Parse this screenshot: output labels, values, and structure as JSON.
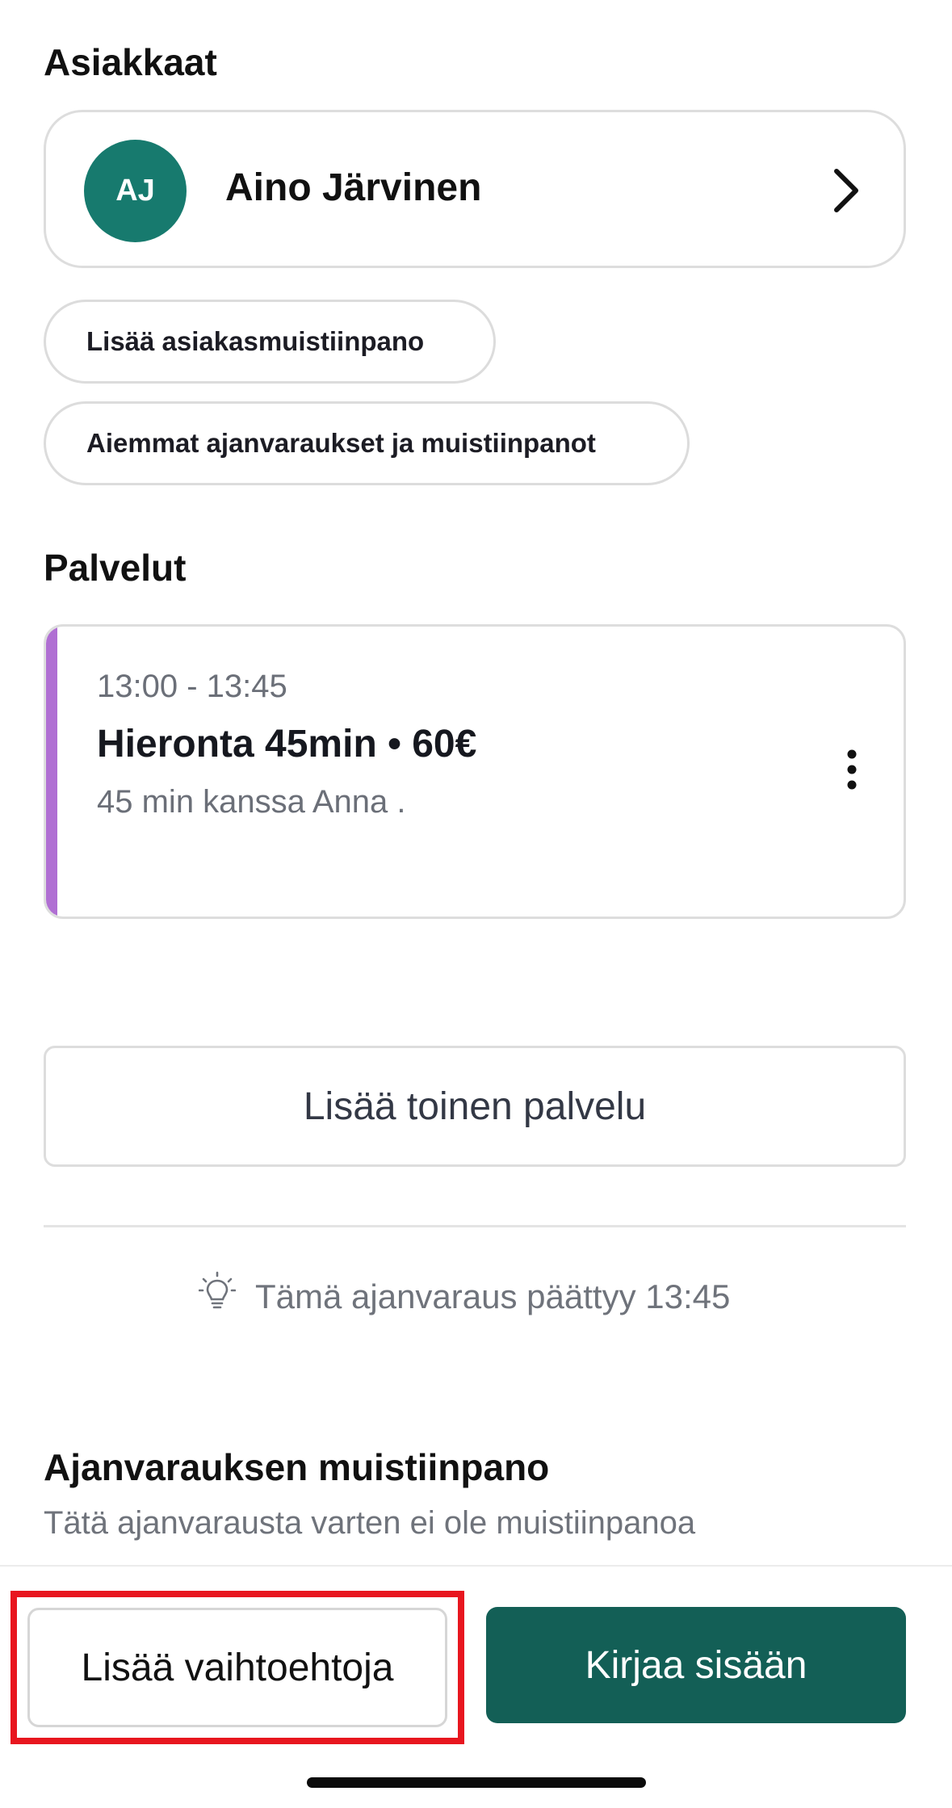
{
  "clients": {
    "section_title": "Asiakkaat",
    "client": {
      "initials": "AJ",
      "name": "Aino Järvinen",
      "avatar_color": "#177a6e"
    },
    "add_note_label": "Lisää asiakasmuistiinpano",
    "history_label": "Aiemmat ajanvaraukset ja muistiinpanot"
  },
  "services": {
    "section_title": "Palvelut",
    "items": [
      {
        "time": "13:00 - 13:45",
        "title": "Hieronta 45min • 60€",
        "meta": "45 min kanssa Anna .",
        "accent_color": "#b06fd3"
      }
    ],
    "add_service_label": "Lisää toinen palvelu"
  },
  "hint": {
    "text": "Tämä ajanvaraus päättyy 13:45",
    "icon": "lightbulb-icon"
  },
  "booking_note": {
    "title": "Ajanvarauksen muistiinpano",
    "empty_text": "Tätä ajanvarausta varten ei ole muistiinpanoa"
  },
  "actions": {
    "more_options_label": "Lisää vaihtoehtoja",
    "check_in_label": "Kirjaa sisään",
    "primary_color": "#135f56",
    "highlight_color": "#e8161f"
  }
}
